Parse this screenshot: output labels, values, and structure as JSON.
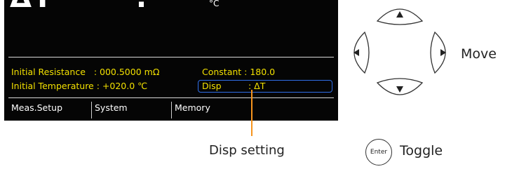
{
  "display": {
    "big_reading": "ΔT·−   ·.·",
    "big_unit": "°C",
    "initial_resistance": "Initial Resistance   : 000.5000 mΩ",
    "constant": "Constant : 180.0",
    "initial_temperature": "Initial Temperature : +020.0 ℃",
    "disp_label": "Disp",
    "disp_value": ": ΔT",
    "text_color": "#f2e000",
    "highlight_color": "#2f6fe8"
  },
  "softkeys": [
    {
      "label": "Meas.Setup"
    },
    {
      "label": "System"
    },
    {
      "label": "Memory"
    }
  ],
  "callout": {
    "label": "Disp setting",
    "line_color": "#f7941d"
  },
  "controls": {
    "move_label": "Move",
    "enter_key_label": "Enter",
    "toggle_label": "Toggle",
    "arrow_icons": [
      "arrow-up-icon",
      "arrow-left-icon",
      "arrow-right-icon",
      "arrow-down-icon"
    ]
  }
}
